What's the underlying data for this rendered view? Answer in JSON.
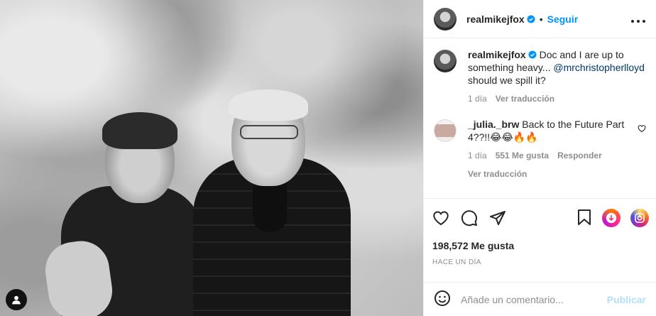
{
  "post": {
    "image_alt": "",
    "author": {
      "username": "realmikejfox",
      "verified": true,
      "follow_label": "Seguir",
      "separator": "•"
    },
    "caption": {
      "username": "realmikejfox",
      "text": " Doc and I are up to something heavy... ",
      "mention": "@mrchristopherlloyd",
      "text_after": " should we spill it?",
      "time": "1 día",
      "translate_label": "Ver traducción"
    },
    "comments": [
      {
        "username": "_julia._brw",
        "text": " Back to the Future Part 4??!!😂😂🔥🔥",
        "time": "1 día",
        "likes": "551 Me gusta",
        "reply_label": "Responder",
        "translate_label": "Ver traducción"
      }
    ],
    "likes_count": "198,572 Me gusta",
    "posted_ago": "HACE UN DÍA",
    "add_comment": {
      "placeholder": "Añade un comentario...",
      "publish_label": "Publicar"
    }
  },
  "colors": {
    "accent": "#0095f6",
    "mention": "#00376b",
    "muted": "#8e8e8e",
    "publish_disabled": "#b2dffc",
    "verified": "#0095f6"
  },
  "icons": [
    "user-tag-icon",
    "verified-badge-icon",
    "more-options-icon",
    "heart-icon",
    "comment-icon",
    "share-icon",
    "bookmark-icon",
    "reel-remix-icon",
    "instagram-logo-icon",
    "emoji-icon"
  ]
}
